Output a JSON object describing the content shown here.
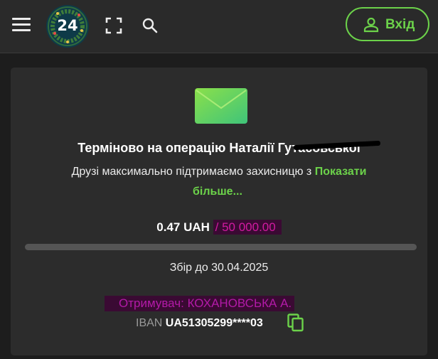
{
  "header": {
    "logo_text": "24",
    "login_label": "Вхід",
    "icons": [
      "menu-icon",
      "fullscreen-icon",
      "search-icon",
      "user-icon"
    ],
    "colors": {
      "background": "#2a2a2a",
      "accent": "#6cd24a"
    }
  },
  "fundraiser": {
    "title": "Терміново на операцію Наталії Гутасовської",
    "description": "Друзі максимально підтримаємо захисницю з",
    "show_more_part1": "Показати",
    "show_more_part2": "більше...",
    "amount_raised": "0.47 UAH",
    "amount_goal": "/ 50 000.00",
    "progress_percent": 0.001,
    "deadline": "Збір до 30.04.2025",
    "recipient": "Отримувач: КОХАНОВСЬКА А.",
    "iban_label": "IBAN",
    "iban_value": "UA51305299****03",
    "icons": [
      "envelope-icon",
      "copy-icon"
    ],
    "colors": {
      "card": "#2c2c2c",
      "goal": "#d21aa0",
      "show_more": "#6cd24a"
    }
  }
}
